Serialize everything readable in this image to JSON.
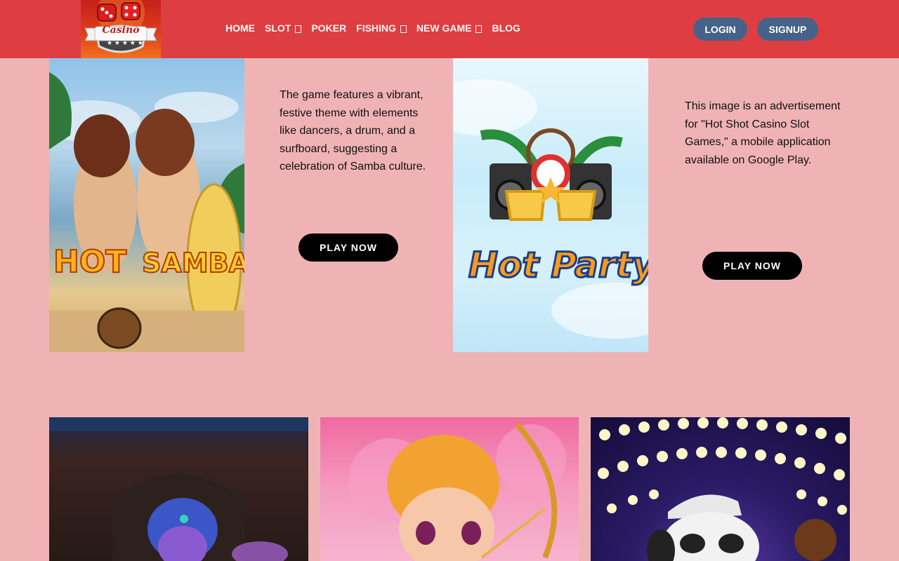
{
  "header": {
    "logo_text": "Casino",
    "nav": [
      {
        "label": "HOME",
        "dropdown": false
      },
      {
        "label": "SLOT",
        "dropdown": true
      },
      {
        "label": "POKER",
        "dropdown": false
      },
      {
        "label": "FISHING",
        "dropdown": true
      },
      {
        "label": "NEW GAME",
        "dropdown": true
      },
      {
        "label": "BLOG",
        "dropdown": false
      }
    ],
    "login_label": "LOGIN",
    "signup_label": "SIGNUP"
  },
  "games": [
    {
      "title_art": "HOT SAMBA",
      "description": "The game features a vibrant, festive theme with elements like dancers, a drum, and a surfboard, suggesting a celebration of Samba culture.",
      "play_label": "PLAY NOW"
    },
    {
      "title_art": "Hot Party",
      "description": "This image is an advertisement for \"Hot Shot Casino Slot Games,\" a mobile application available on Google Play.",
      "play_label": "PLAY NOW"
    }
  ],
  "colors": {
    "header_bg": "#de3e41",
    "page_bg": "#f0b3b5",
    "auth_button_bg": "#466288",
    "play_button_bg": "#000000"
  }
}
